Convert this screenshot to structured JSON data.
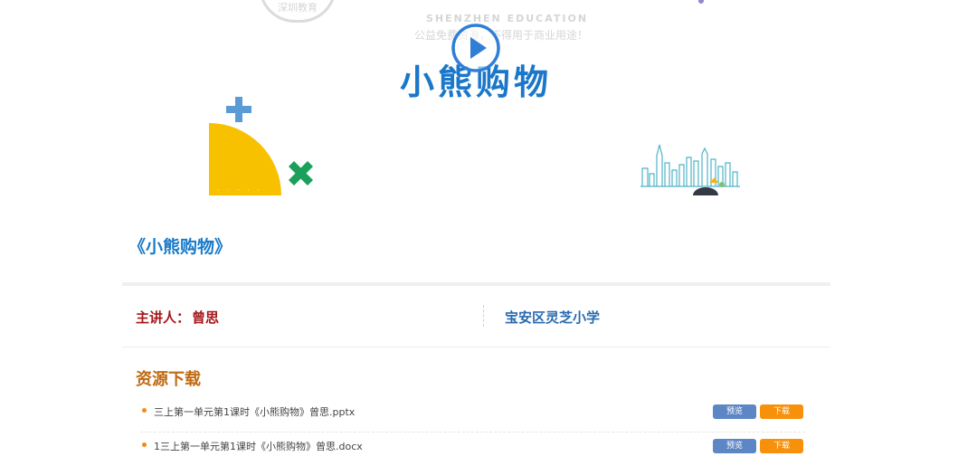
{
  "video": {
    "watermark": {
      "seal_text": "深圳教育",
      "english_text": "SHENZHEN EDUCATION",
      "notice_text": "公益免费资源，不得用于商业用途！"
    },
    "slide_title": "小熊购物",
    "controls": {
      "play_icon": "play-circle-icon"
    }
  },
  "lesson": {
    "title": "《小熊购物》"
  },
  "speaker": {
    "label": "主讲人：",
    "name": "曾思"
  },
  "school": {
    "name": "宝安区灵芝小学"
  },
  "resources": {
    "heading": "资源下载",
    "files": [
      {
        "name": "三上第一单元第1课时《小熊购物》曾思.pptx",
        "preview_label": "预览",
        "download_label": "下载"
      },
      {
        "name": "1三上第一单元第1课时《小熊购物》曾思.docx",
        "preview_label": "预览",
        "download_label": "下载"
      }
    ]
  },
  "colors": {
    "title_blue": "#1a77c9",
    "speaker_red": "#a4161a",
    "school_blue": "#2a6ab0",
    "heading_brown": "#c06a12",
    "preview_button": "#5d86c5",
    "download_button": "#f7900b",
    "shape_yellow": "#f8c100",
    "plus_blue": "#5b9bd5",
    "times_green": "#1aa05a"
  }
}
